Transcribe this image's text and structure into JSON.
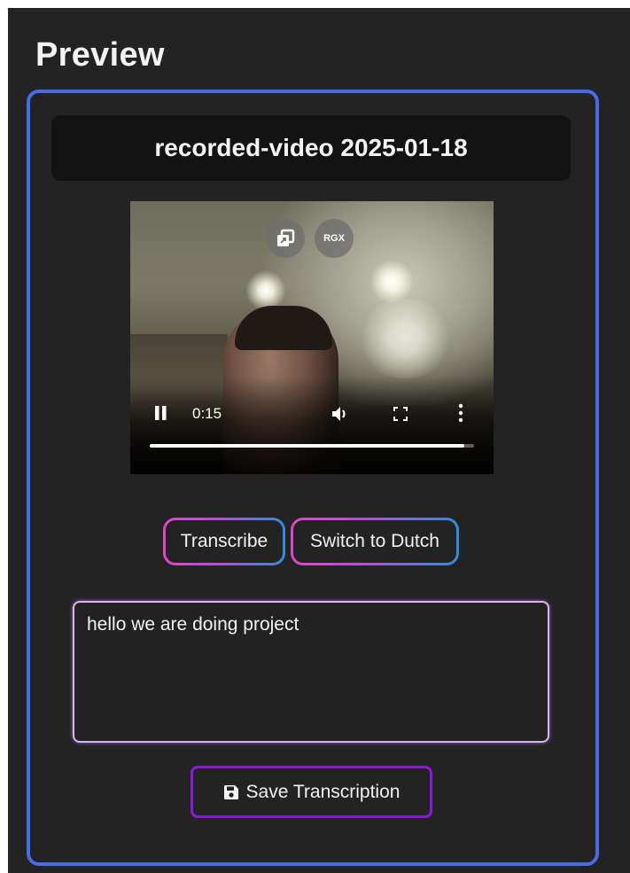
{
  "page": {
    "title": "Preview"
  },
  "preview": {
    "video_title": "recorded-video 2025-01-18",
    "player": {
      "pip_icon": "picture-in-picture-icon",
      "overlay_badge": "RGX",
      "current_time": "0:15",
      "progress": 0.97,
      "state": "playing",
      "icons": [
        "pause-icon",
        "volume-icon",
        "fullscreen-icon",
        "more-options-icon"
      ]
    },
    "buttons": {
      "transcribe_label": "Transcribe",
      "switch_language_label": "Switch to Dutch",
      "save_label": "Save Transcription",
      "save_icon": "floppy-disk-icon"
    },
    "transcription": {
      "text": "hello we are doing project"
    }
  },
  "colors": {
    "background": "#232323",
    "card_border": "#4a6be8",
    "gradient_start": "#e046c8",
    "gradient_end": "#2f8fd6",
    "save_border": "#8a19d8",
    "textbox_border": "#d7b6ec"
  }
}
